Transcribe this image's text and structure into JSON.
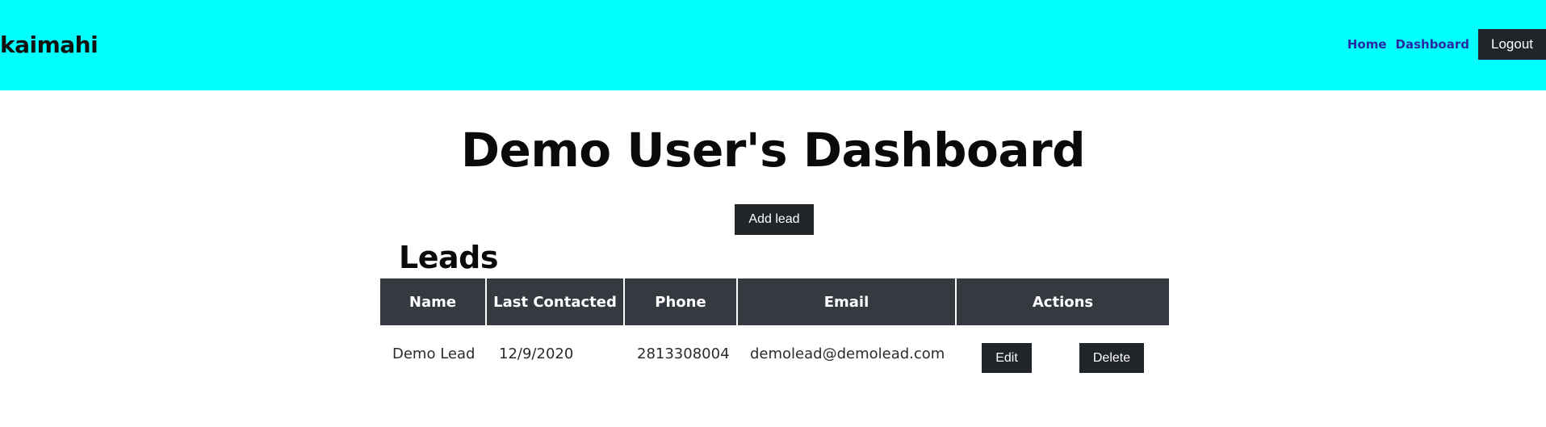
{
  "navbar": {
    "brand": "kaimahi",
    "links": [
      {
        "label": "Home"
      },
      {
        "label": "Dashboard"
      }
    ],
    "logout_label": "Logout",
    "background_color": "#00ffff"
  },
  "page": {
    "title": "Demo User's Dashboard",
    "add_lead_label": "Add lead"
  },
  "leads": {
    "heading": "Leads",
    "columns": [
      "Name",
      "Last Contacted",
      "Phone",
      "Email",
      "Actions"
    ],
    "rows": [
      {
        "name": "Demo Lead",
        "last_contacted": "12/9/2020",
        "phone": "2813308004",
        "email": "demolead@demolead.com",
        "edit_label": "Edit",
        "delete_label": "Delete"
      }
    ]
  }
}
